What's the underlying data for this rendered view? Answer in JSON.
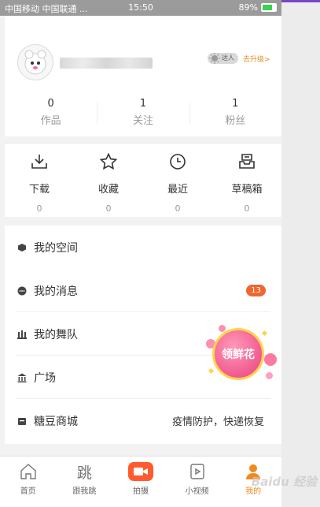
{
  "statusbar": {
    "carrier": "中国移动 中国联通 ...",
    "time": "15:50",
    "battery": "89%"
  },
  "profile": {
    "level_badge": "达人",
    "upgrade": "去升级>",
    "stats": [
      {
        "value": "0",
        "label": "作品"
      },
      {
        "value": "1",
        "label": "关注"
      },
      {
        "value": "1",
        "label": "粉丝"
      }
    ]
  },
  "quick": [
    {
      "label": "下载",
      "count": "0",
      "icon": "download-icon"
    },
    {
      "label": "收藏",
      "count": "0",
      "icon": "star-icon"
    },
    {
      "label": "最近",
      "count": "0",
      "icon": "clock-icon"
    },
    {
      "label": "草稿箱",
      "count": "0",
      "icon": "drafts-icon"
    }
  ],
  "menu": [
    {
      "label": "我的空间",
      "icon": "cube-icon"
    },
    {
      "label": "我的消息",
      "icon": "message-icon",
      "count": "13"
    },
    {
      "label": "我的舞队",
      "icon": "team-icon"
    },
    {
      "label": "广场",
      "icon": "plaza-icon"
    },
    {
      "label": "糖豆商城",
      "icon": "shop-icon",
      "note": "疫情防护，快递恢复"
    }
  ],
  "promo": {
    "label": "领鲜花"
  },
  "tabbar": [
    {
      "label": "首页",
      "icon": "home-icon"
    },
    {
      "label": "跟我跳",
      "icon": "dance-icon",
      "glyph": "跳"
    },
    {
      "label": "拍摄",
      "icon": "camera-icon"
    },
    {
      "label": "小视频",
      "icon": "video-icon"
    },
    {
      "label": "我的",
      "icon": "person-icon",
      "active": true
    }
  ],
  "colors": {
    "accent": "#f08a1c",
    "badge": "#f0662c",
    "shoot": "#ff5b2e",
    "status_bar": "#9b9b9b"
  },
  "watermark": "Baidu 经验"
}
